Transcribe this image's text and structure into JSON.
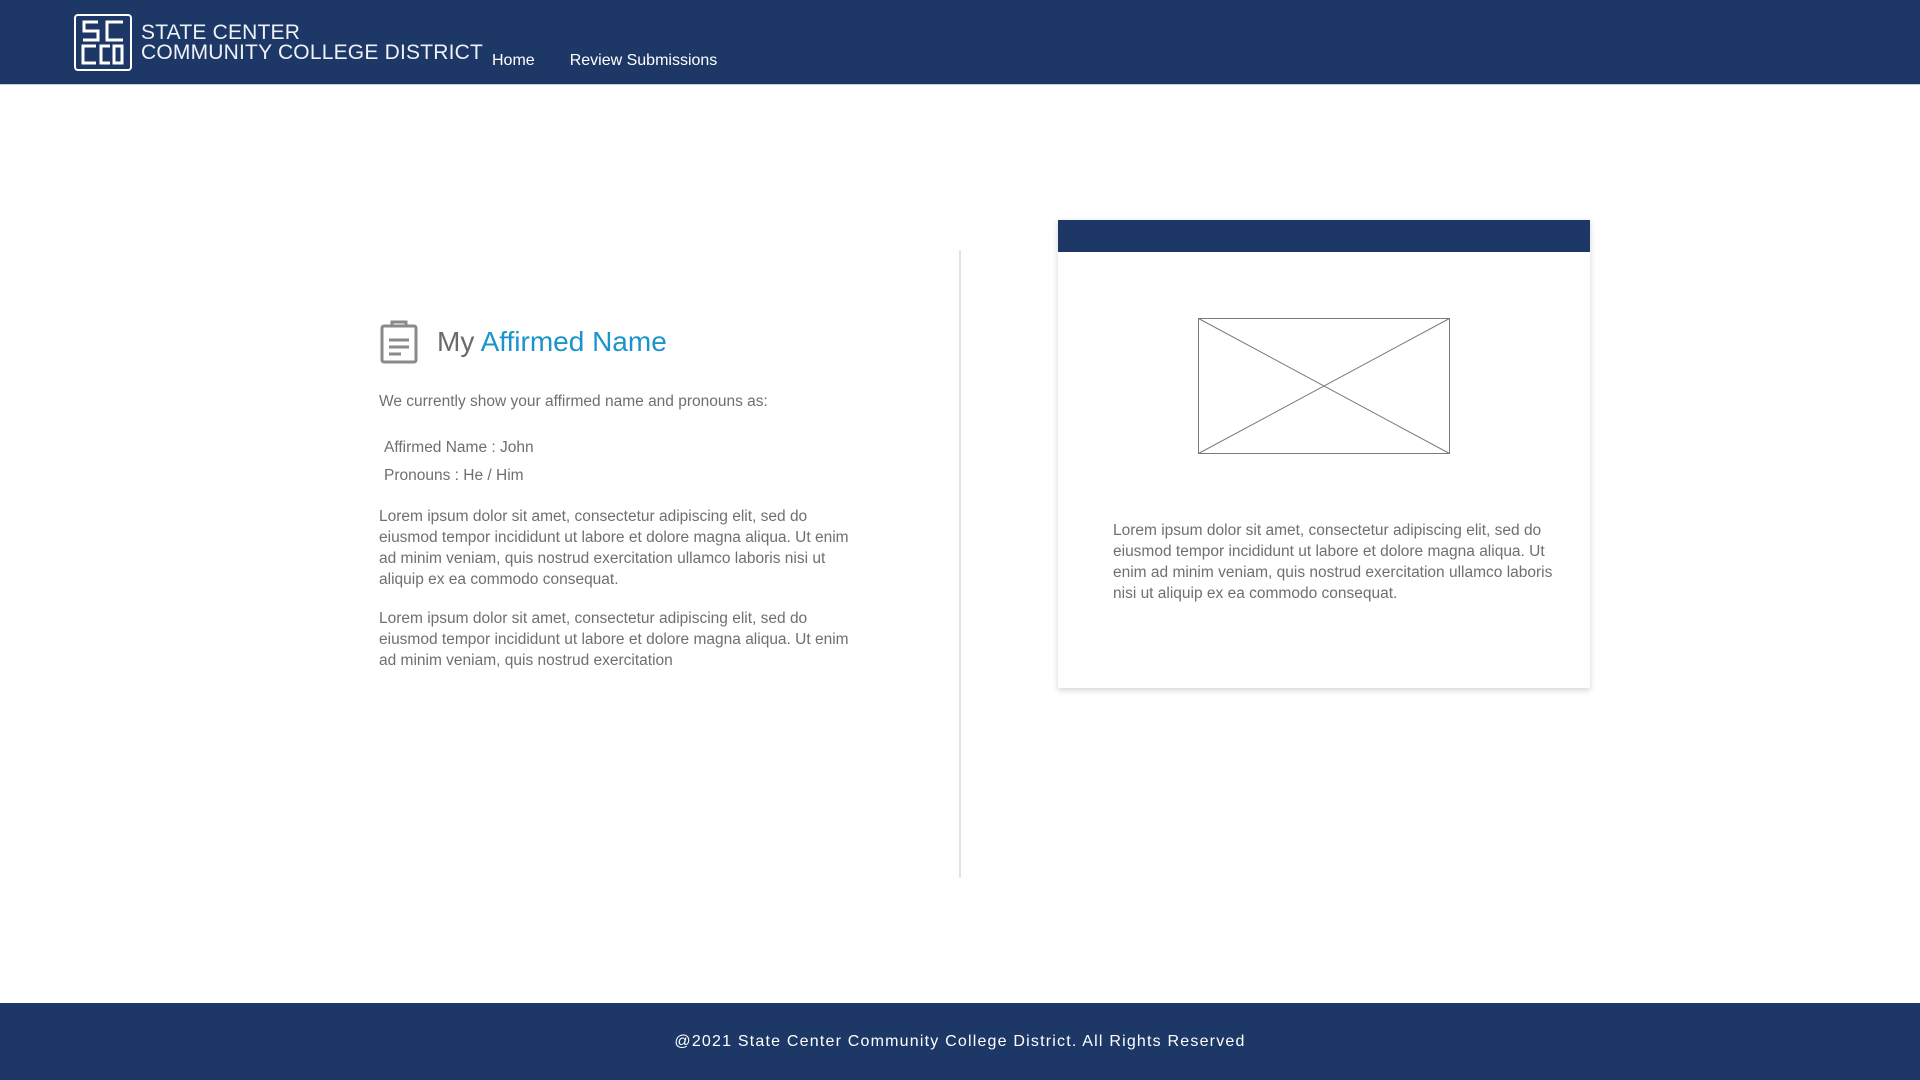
{
  "header": {
    "logo_icon": "sccd-logo-icon",
    "brand_line1": "STATE CENTER",
    "brand_line2": "COMMUNITY COLLEGE DISTRICT",
    "nav": [
      {
        "label": "Home"
      },
      {
        "label": "Review Submissions"
      }
    ],
    "background_color": "#1d3866"
  },
  "main": {
    "heading_icon": "clipboard-icon",
    "heading_prefix": "My",
    "heading_accent": "Affirmed Name",
    "accent_color": "#1b93cc",
    "intro": "We currently show your affirmed name and pronouns as:",
    "affirmed_name": "Affirmed Name : John",
    "pronouns": "Pronouns : He / Him",
    "paragraph1": "Lorem ipsum dolor sit amet, consectetur adipiscing elit, sed do eiusmod tempor incididunt ut labore et dolore magna aliqua. Ut enim ad minim veniam, quis nostrud exercitation ullamco laboris nisi ut aliquip ex ea commodo consequat.",
    "paragraph2": "Lorem ipsum dolor sit amet, consectetur adipiscing elit, sed do eiusmod tempor incididunt ut labore et dolore magna aliqua. Ut enim ad minim veniam, quis nostrud exercitation"
  },
  "card": {
    "image_icon": "image-placeholder-icon",
    "text": "Lorem ipsum dolor sit amet, consectetur adipiscing elit, sed do eiusmod tempor incididunt ut labore et dolore magna aliqua. Ut enim ad minim veniam, quis nostrud exercitation ullamco laboris nisi ut aliquip ex ea commodo consequat."
  },
  "footer": {
    "text": "@2021 State Center Community College District. All Rights Reserved"
  }
}
